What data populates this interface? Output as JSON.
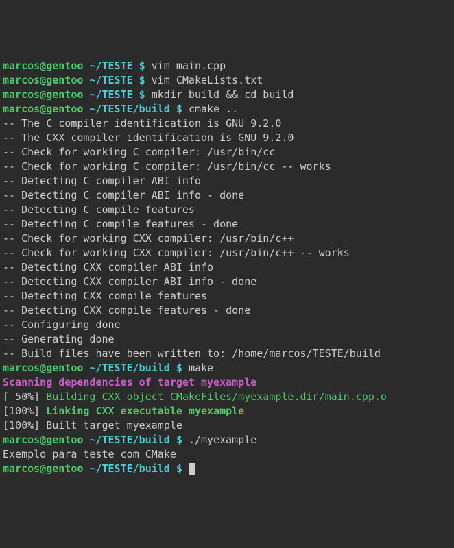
{
  "prompts": {
    "user": "marcos@gentoo",
    "path1": "~/TESTE",
    "path2": "~/TESTE/build",
    "sep": " $ "
  },
  "lines": [
    {
      "type": "prompt",
      "path": "path1",
      "cmd": "vim main.cpp"
    },
    {
      "type": "prompt",
      "path": "path1",
      "cmd": "vim CMakeLists.txt"
    },
    {
      "type": "prompt",
      "path": "path1",
      "cmd": "mkdir build && cd build"
    },
    {
      "type": "prompt",
      "path": "path2",
      "cmd": "cmake .."
    },
    {
      "type": "output",
      "text": "-- The C compiler identification is GNU 9.2.0"
    },
    {
      "type": "output",
      "text": "-- The CXX compiler identification is GNU 9.2.0"
    },
    {
      "type": "output",
      "text": "-- Check for working C compiler: /usr/bin/cc"
    },
    {
      "type": "output",
      "text": "-- Check for working C compiler: /usr/bin/cc -- works"
    },
    {
      "type": "output",
      "text": "-- Detecting C compiler ABI info"
    },
    {
      "type": "output",
      "text": "-- Detecting C compiler ABI info - done"
    },
    {
      "type": "output",
      "text": "-- Detecting C compile features"
    },
    {
      "type": "output",
      "text": "-- Detecting C compile features - done"
    },
    {
      "type": "output",
      "text": "-- Check for working CXX compiler: /usr/bin/c++"
    },
    {
      "type": "output",
      "text": "-- Check for working CXX compiler: /usr/bin/c++ -- works"
    },
    {
      "type": "output",
      "text": "-- Detecting CXX compiler ABI info"
    },
    {
      "type": "output",
      "text": "-- Detecting CXX compiler ABI info - done"
    },
    {
      "type": "output",
      "text": "-- Detecting CXX compile features"
    },
    {
      "type": "output",
      "text": "-- Detecting CXX compile features - done"
    },
    {
      "type": "output",
      "text": "-- Configuring done"
    },
    {
      "type": "output",
      "text": "-- Generating done"
    },
    {
      "type": "output",
      "text": "-- Build files have been written to: /home/marcos/TESTE/build"
    },
    {
      "type": "prompt",
      "path": "path2",
      "cmd": "make"
    },
    {
      "type": "magenta",
      "text": "Scanning dependencies of target myexample"
    },
    {
      "type": "build",
      "prefix": "[ 50%] ",
      "text": "Building CXX object CMakeFiles/myexample.dir/main.cpp.o"
    },
    {
      "type": "buildlink",
      "prefix": "[100%] ",
      "text": "Linking CXX executable myexample"
    },
    {
      "type": "output",
      "text": "[100%] Built target myexample"
    },
    {
      "type": "prompt",
      "path": "path2",
      "cmd": "./myexample"
    },
    {
      "type": "output",
      "text": "Exemplo para teste com CMake"
    },
    {
      "type": "prompt",
      "path": "path2",
      "cmd": "",
      "cursor": true
    }
  ]
}
